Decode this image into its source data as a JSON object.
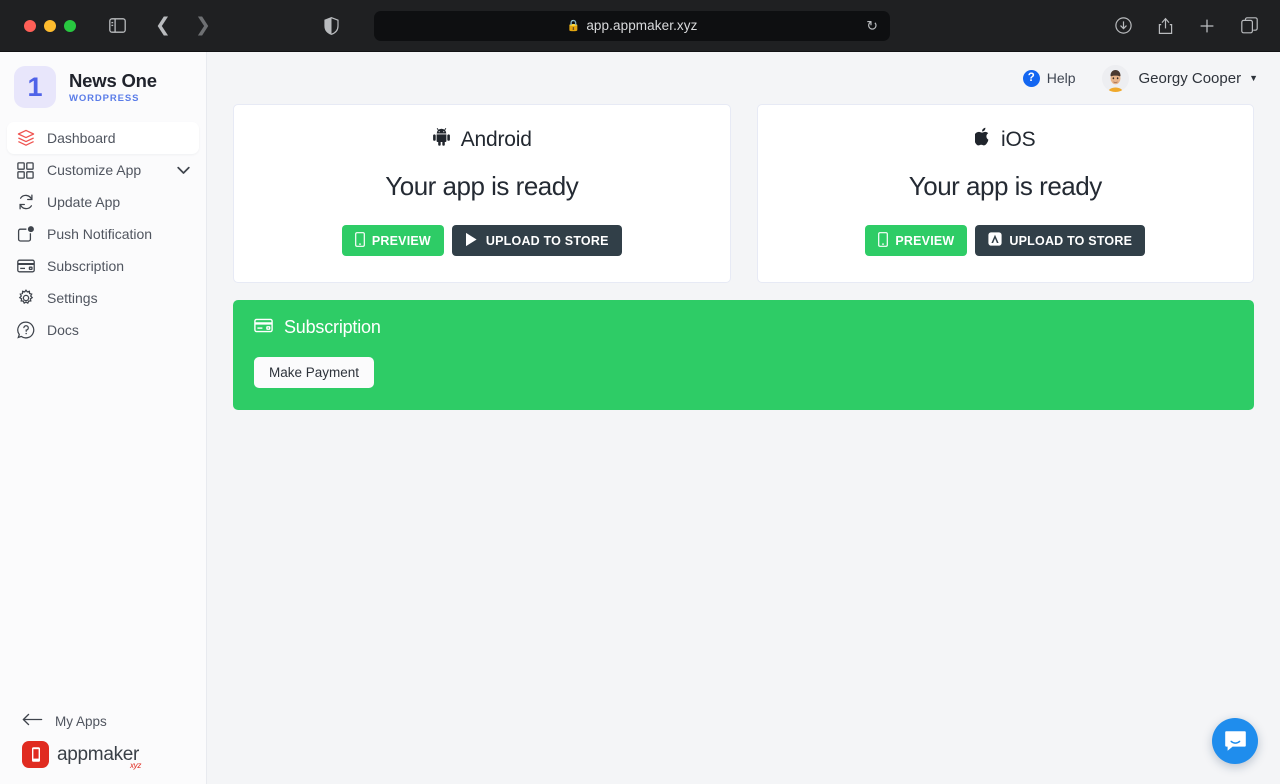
{
  "browser": {
    "url": "app.appmaker.xyz",
    "lock_icon": "lock-icon",
    "reload_icon": "reload-icon",
    "sidebar_toggle_icon": "sidebar-toggle-icon",
    "back_icon": "back-arrow-icon",
    "forward_icon": "forward-arrow-icon",
    "shield_icon": "shield-privacy-icon",
    "downloads_icon": "downloads-icon",
    "share_icon": "share-icon",
    "new_tab_icon": "new-tab-icon",
    "tab_overview_icon": "tab-overview-icon"
  },
  "sidebar": {
    "brand": {
      "badge": "1",
      "title": "News One",
      "subtitle": "WORDPRESS"
    },
    "items": [
      {
        "label": "Dashboard",
        "icon": "layers-icon",
        "active": true,
        "chevron": false
      },
      {
        "label": "Customize App",
        "icon": "grid-icon",
        "active": false,
        "chevron": true
      },
      {
        "label": "Update App",
        "icon": "refresh-icon",
        "active": false,
        "chevron": false
      },
      {
        "label": "Push Notification",
        "icon": "notification-icon",
        "active": false,
        "chevron": false
      },
      {
        "label": "Subscription",
        "icon": "credit-card-icon",
        "active": false,
        "chevron": false
      },
      {
        "label": "Settings",
        "icon": "gear-icon",
        "active": false,
        "chevron": false
      },
      {
        "label": "Docs",
        "icon": "question-icon",
        "active": false,
        "chevron": false
      }
    ],
    "my_apps": {
      "label": "My Apps",
      "icon": "back-arrow-icon"
    },
    "footer_logo": {
      "word": "appmaker",
      "suffix": "xyz",
      "icon": "appmaker-phone-icon"
    }
  },
  "topbar": {
    "help_label": "Help",
    "help_icon": "question-circle-icon",
    "user_name": "Georgy Cooper",
    "avatar_icon": "user-avatar",
    "caret_icon": "chevron-down-icon"
  },
  "cards": [
    {
      "platform": "Android",
      "platform_icon": "android-icon",
      "status": "Your app is ready",
      "preview_label": "PREVIEW",
      "preview_icon": "mobile-icon",
      "upload_label": "UPLOAD TO STORE",
      "upload_icon": "google-play-icon"
    },
    {
      "platform": "iOS",
      "platform_icon": "apple-icon",
      "status": "Your app is ready",
      "preview_label": "PREVIEW",
      "preview_icon": "mobile-icon",
      "upload_label": "UPLOAD TO STORE",
      "upload_icon": "app-store-icon"
    }
  ],
  "subscription": {
    "title": "Subscription",
    "icon": "credit-card-icon",
    "action_label": "Make Payment"
  },
  "chat": {
    "icon": "chat-bubble-icon"
  },
  "colors": {
    "green": "#2ecc66",
    "dark_button": "#313f48",
    "accent_blue": "#5a7ce8",
    "help_blue": "#1366f1",
    "logo_red": "#e02b20",
    "page_bg": "#f4f5f7"
  }
}
